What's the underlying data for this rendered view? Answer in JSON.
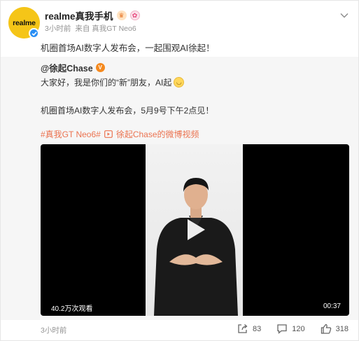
{
  "author": {
    "avatar_text": "realme",
    "name": "realme真我手机",
    "meta_time": "3小时前",
    "meta_source": "来自 真我GT Neo6"
  },
  "post": {
    "text": "机圈首场AI数字人发布会，一起围观AI徐起！"
  },
  "repost": {
    "user": "@徐起Chase",
    "line1": "大家好，我是你们的“新”朋友，AI起",
    "line2": "机圈首场AI数字人发布会，5月9号下午2点见！",
    "hashtag": "#真我GT Neo6#",
    "video_link": "徐起Chase的微博视频",
    "video": {
      "views": "40.2万次观看",
      "duration": "00:37"
    },
    "time": "3小时前"
  },
  "actions": {
    "share_count": "83",
    "comment_count": "120",
    "like_count": "318"
  },
  "colors": {
    "brand_yellow": "#f5c518",
    "link_orange": "#eb7350",
    "verified_blue": "#2a8ff5"
  }
}
